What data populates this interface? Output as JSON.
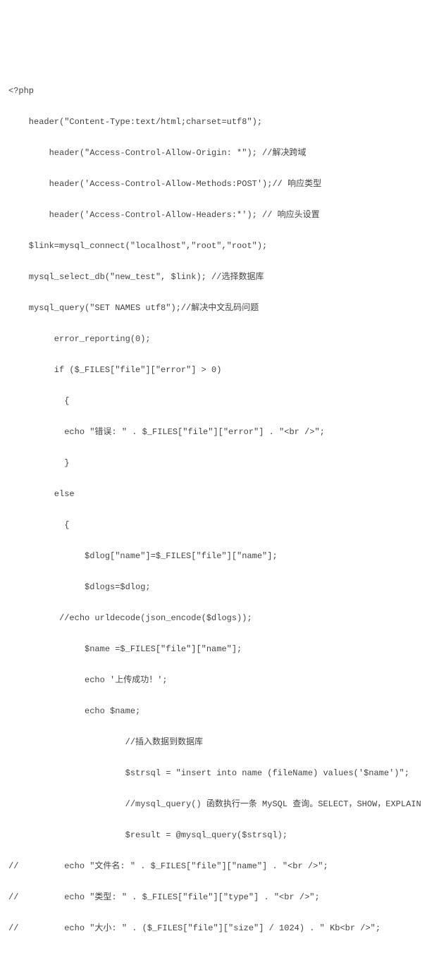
{
  "code": {
    "lines": [
      "<?php",
      "    header(\"Content-Type:text/html;charset=utf8\");",
      "        header(\"Access-Control-Allow-Origin: *\"); //解决跨域",
      "        header('Access-Control-Allow-Methods:POST');// 响应类型",
      "        header('Access-Control-Allow-Headers:*'); // 响应头设置",
      "    $link=mysql_connect(\"localhost\",\"root\",\"root\");",
      "    mysql_select_db(\"new_test\", $link); //选择数据库",
      "    mysql_query(\"SET NAMES utf8\");//解决中文乱码问题",
      "         error_reporting(0);",
      "         if ($_FILES[\"file\"][\"error\"] > 0)",
      "           {",
      "           echo \"错误: \" . $_FILES[\"file\"][\"error\"] . \"<br />\";",
      "           }",
      "         else",
      "           {",
      "               $dlog[\"name\"]=$_FILES[\"file\"][\"name\"];",
      "               $dlogs=$dlog;",
      "          //echo urldecode(json_encode($dlogs));",
      "               $name =$_FILES[\"file\"][\"name\"];",
      "               echo '上传成功！';",
      "               echo $name;",
      "                       //插入数据到数据库",
      "                       $strsql = \"insert into name (fileName) values('$name')\";",
      "                       //mysql_query() 函数执行一条 MySQL 查询。SELECT，SHOW，EXPLAIN",
      "                       $result = @mysql_query($strsql);",
      "//         echo \"文件名: \" . $_FILES[\"file\"][\"name\"] . \"<br />\";",
      "//         echo \"类型: \" . $_FILES[\"file\"][\"type\"] . \"<br />\";",
      "//         echo \"大小: \" . ($_FILES[\"file\"][\"size\"] / 1024) . \" Kb<br />\";"
    ]
  }
}
